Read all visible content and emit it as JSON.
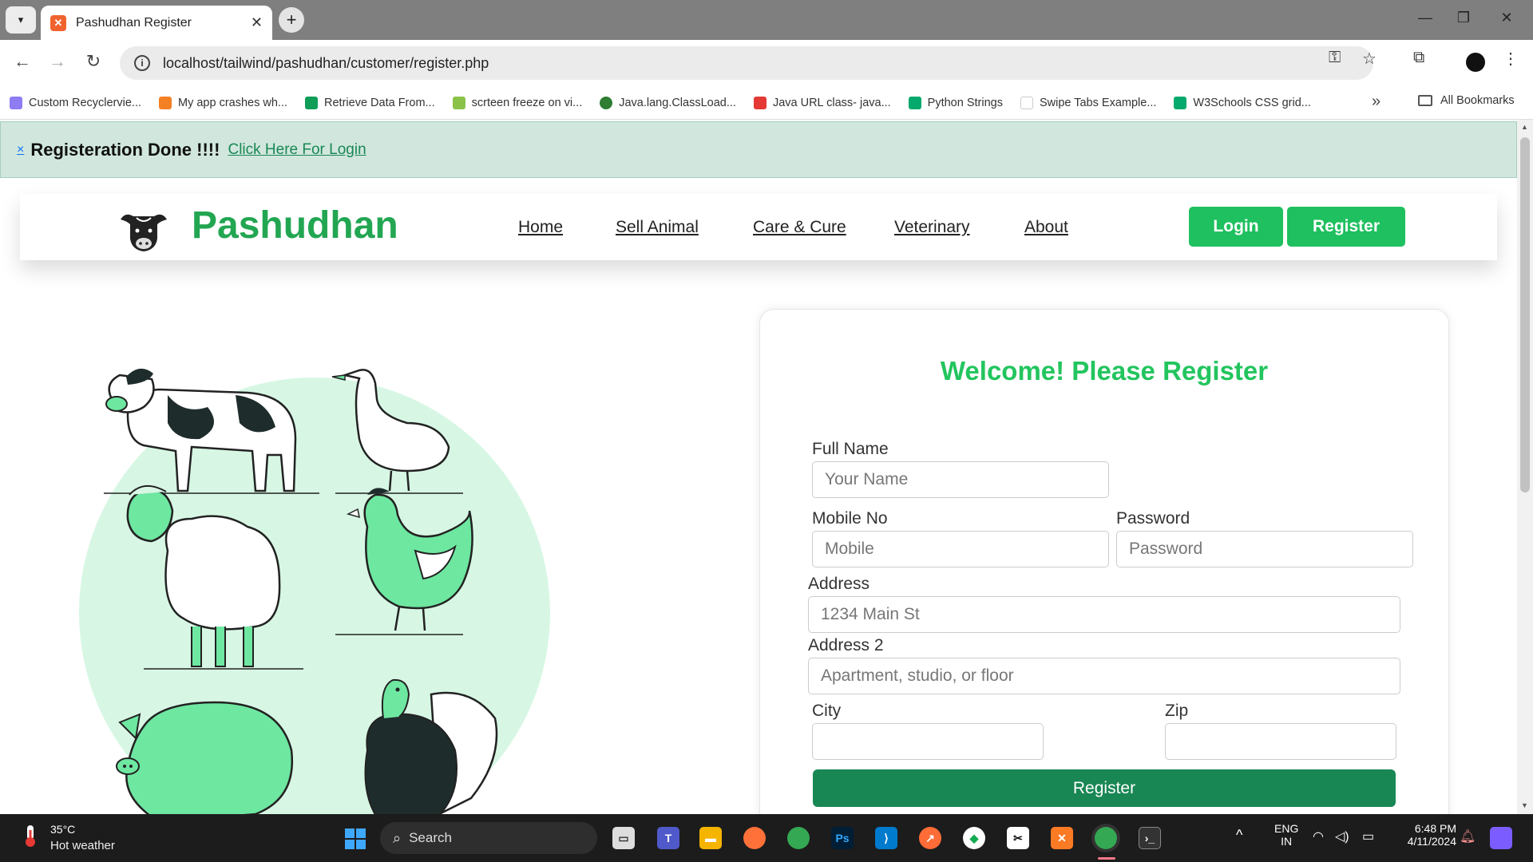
{
  "browser": {
    "tab_title": "Pashudhan Register",
    "url": "localhost/tailwind/pashudhan/customer/register.php",
    "bookmarks": [
      {
        "label": "Custom Recyclervie...",
        "color": "#8e7cf3"
      },
      {
        "label": "My app crashes wh...",
        "color": "#f48024"
      },
      {
        "label": "Retrieve Data From...",
        "color": "#0f9d58"
      },
      {
        "label": "scrteen freeze on vi...",
        "color": "#8bc34a"
      },
      {
        "label": "Java.lang.ClassLoad...",
        "color": "#2e7d32"
      },
      {
        "label": "Java URL class- java...",
        "color": "#e53935"
      },
      {
        "label": "Python Strings",
        "color": "#04aa6d"
      },
      {
        "label": "Swipe Tabs Example...",
        "color": "#ffffff"
      },
      {
        "label": "W3Schools CSS grid...",
        "color": "#04aa6d"
      }
    ],
    "all_bookmarks": "All Bookmarks"
  },
  "alert": {
    "close": "×",
    "message": "Registeration Done !!!!",
    "link": "Click Here For Login"
  },
  "navbar": {
    "brand": "Pashudhan",
    "links": [
      "Home",
      "Sell Animal",
      "Care & Cure",
      "Veterinary",
      "About"
    ],
    "login": "Login",
    "register": "Register"
  },
  "form": {
    "title": "Welcome! Please Register",
    "full_name_label": "Full Name",
    "full_name_placeholder": "Your Name",
    "mobile_label": "Mobile No",
    "mobile_placeholder": "Mobile",
    "password_label": "Password",
    "password_placeholder": "Password",
    "address_label": "Address",
    "address_placeholder": "1234 Main St",
    "address2_label": "Address 2",
    "address2_placeholder": "Apartment, studio, or floor",
    "city_label": "City",
    "zip_label": "Zip",
    "submit": "Register"
  },
  "colors": {
    "brand_green": "#22a652",
    "button_green": "#1fc05f",
    "submit_green": "#198754",
    "alert_bg": "#d1e7dd",
    "blob": "#d7f7e4"
  },
  "taskbar": {
    "temperature": "35°C",
    "weather": "Hot weather",
    "search": "Search",
    "lang_top": "ENG",
    "lang_bottom": "IN",
    "time": "6:48 PM",
    "date": "4/11/2024"
  }
}
